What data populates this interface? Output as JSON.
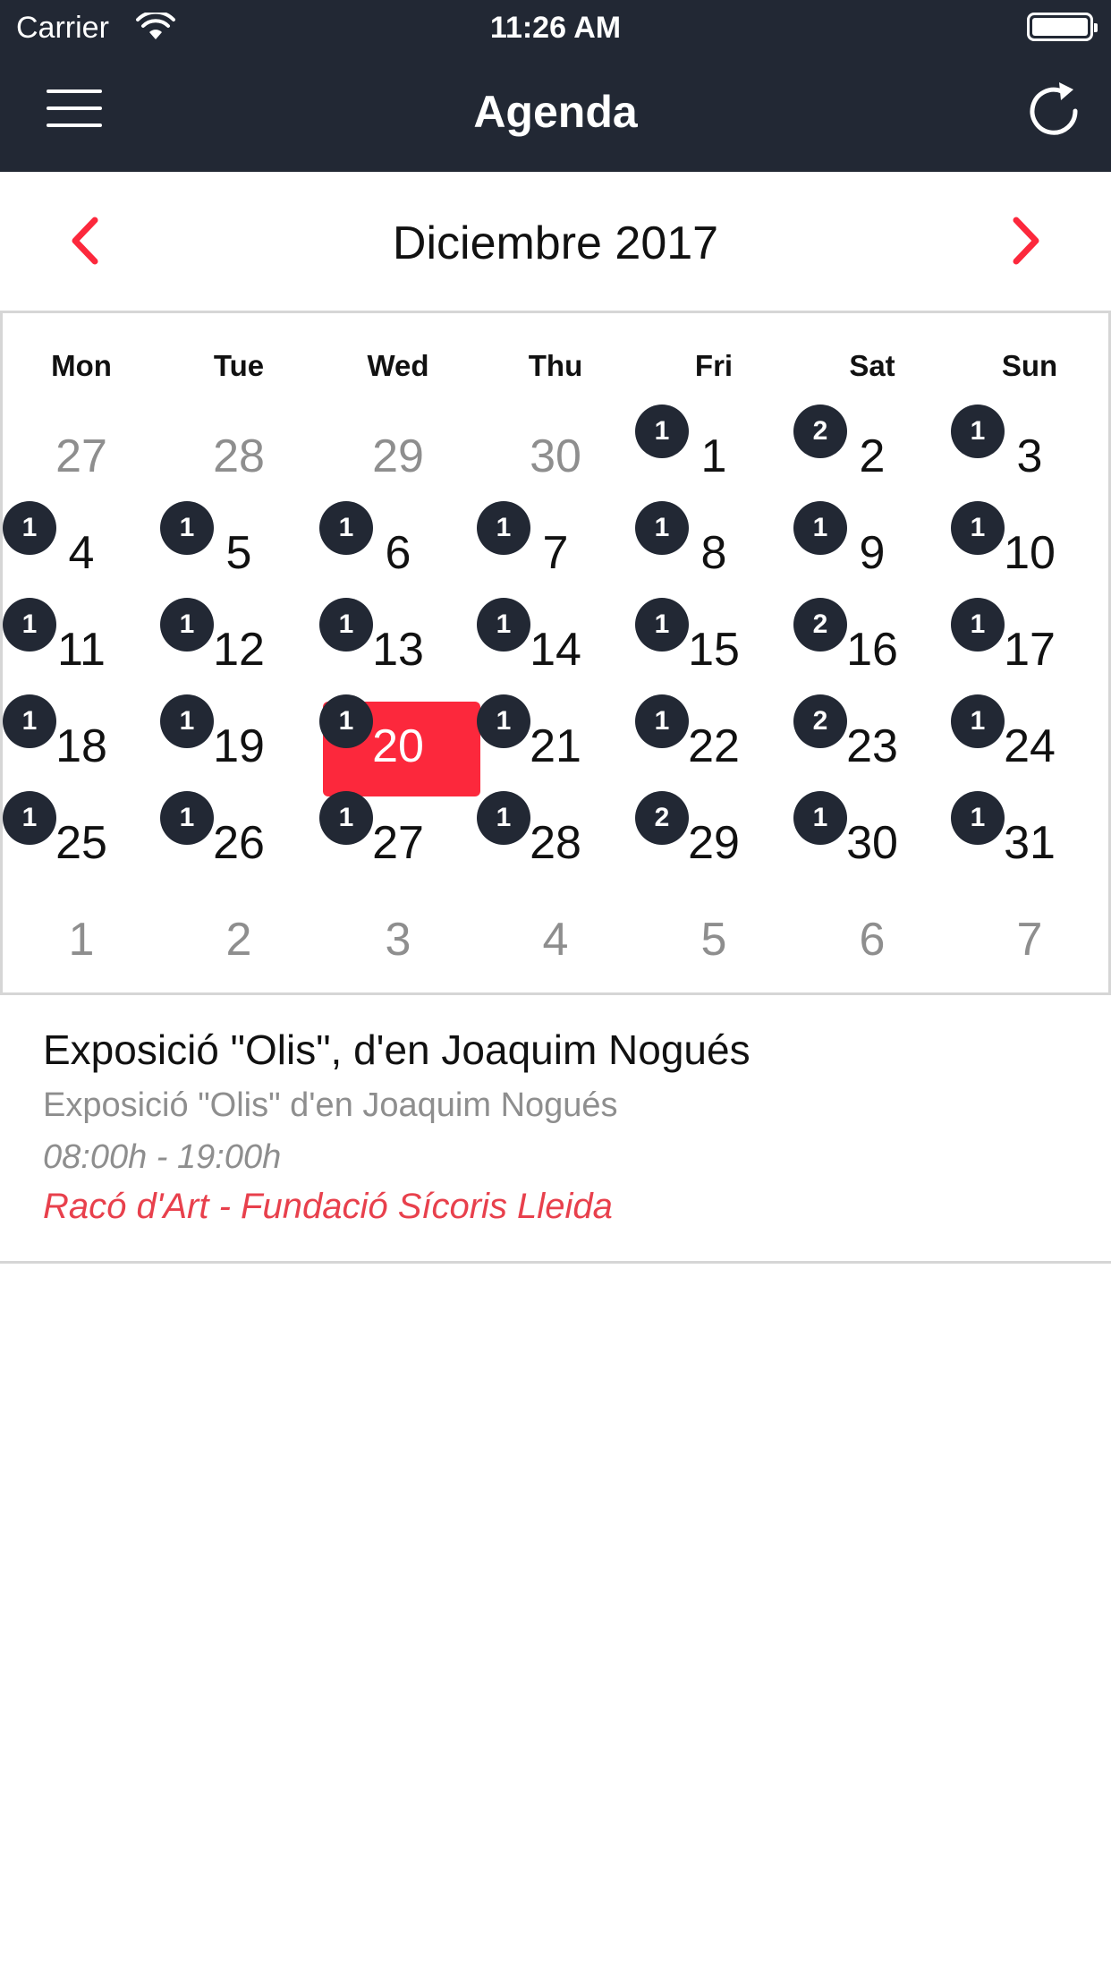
{
  "status_bar": {
    "carrier": "Carrier",
    "time": "11:26 AM"
  },
  "nav": {
    "title": "Agenda"
  },
  "calendar": {
    "month_label": "Diciembre 2017",
    "weekdays": [
      "Mon",
      "Tue",
      "Wed",
      "Thu",
      "Fri",
      "Sat",
      "Sun"
    ],
    "weeks": [
      [
        {
          "day": "27",
          "other": true,
          "badge": ""
        },
        {
          "day": "28",
          "other": true,
          "badge": ""
        },
        {
          "day": "29",
          "other": true,
          "badge": ""
        },
        {
          "day": "30",
          "other": true,
          "badge": ""
        },
        {
          "day": "1",
          "other": false,
          "badge": "1"
        },
        {
          "day": "2",
          "other": false,
          "badge": "2"
        },
        {
          "day": "3",
          "other": false,
          "badge": "1"
        }
      ],
      [
        {
          "day": "4",
          "other": false,
          "badge": "1"
        },
        {
          "day": "5",
          "other": false,
          "badge": "1"
        },
        {
          "day": "6",
          "other": false,
          "badge": "1"
        },
        {
          "day": "7",
          "other": false,
          "badge": "1"
        },
        {
          "day": "8",
          "other": false,
          "badge": "1"
        },
        {
          "day": "9",
          "other": false,
          "badge": "1"
        },
        {
          "day": "10",
          "other": false,
          "badge": "1"
        }
      ],
      [
        {
          "day": "11",
          "other": false,
          "badge": "1"
        },
        {
          "day": "12",
          "other": false,
          "badge": "1"
        },
        {
          "day": "13",
          "other": false,
          "badge": "1"
        },
        {
          "day": "14",
          "other": false,
          "badge": "1"
        },
        {
          "day": "15",
          "other": false,
          "badge": "1"
        },
        {
          "day": "16",
          "other": false,
          "badge": "2"
        },
        {
          "day": "17",
          "other": false,
          "badge": "1"
        }
      ],
      [
        {
          "day": "18",
          "other": false,
          "badge": "1"
        },
        {
          "day": "19",
          "other": false,
          "badge": "1"
        },
        {
          "day": "20",
          "other": false,
          "badge": "1",
          "selected": true
        },
        {
          "day": "21",
          "other": false,
          "badge": "1"
        },
        {
          "day": "22",
          "other": false,
          "badge": "1"
        },
        {
          "day": "23",
          "other": false,
          "badge": "2"
        },
        {
          "day": "24",
          "other": false,
          "badge": "1"
        }
      ],
      [
        {
          "day": "25",
          "other": false,
          "badge": "1"
        },
        {
          "day": "26",
          "other": false,
          "badge": "1"
        },
        {
          "day": "27",
          "other": false,
          "badge": "1"
        },
        {
          "day": "28",
          "other": false,
          "badge": "1"
        },
        {
          "day": "29",
          "other": false,
          "badge": "2"
        },
        {
          "day": "30",
          "other": false,
          "badge": "1"
        },
        {
          "day": "31",
          "other": false,
          "badge": "1"
        }
      ],
      [
        {
          "day": "1",
          "other": true,
          "badge": ""
        },
        {
          "day": "2",
          "other": true,
          "badge": ""
        },
        {
          "day": "3",
          "other": true,
          "badge": ""
        },
        {
          "day": "4",
          "other": true,
          "badge": ""
        },
        {
          "day": "5",
          "other": true,
          "badge": ""
        },
        {
          "day": "6",
          "other": true,
          "badge": ""
        },
        {
          "day": "7",
          "other": true,
          "badge": ""
        }
      ]
    ]
  },
  "events": [
    {
      "title": "Exposició \"Olis\", d'en Joaquim Nogués",
      "subtitle": "Exposició \"Olis\" d'en Joaquim Nogués",
      "time": "08:00h - 19:00h",
      "location": "Racó d'Art - Fundació Sícoris Lleida"
    }
  ],
  "colors": {
    "header_bg": "#222834",
    "accent_red": "#fc283c",
    "badge_bg": "#222834",
    "location_text": "#e8404c",
    "muted_text": "#8e8e8e"
  },
  "icons": {
    "menu": "hamburger-icon",
    "refresh": "refresh-icon",
    "prev": "chevron-left-icon",
    "next": "chevron-right-icon",
    "wifi": "wifi-icon",
    "battery": "battery-icon"
  }
}
